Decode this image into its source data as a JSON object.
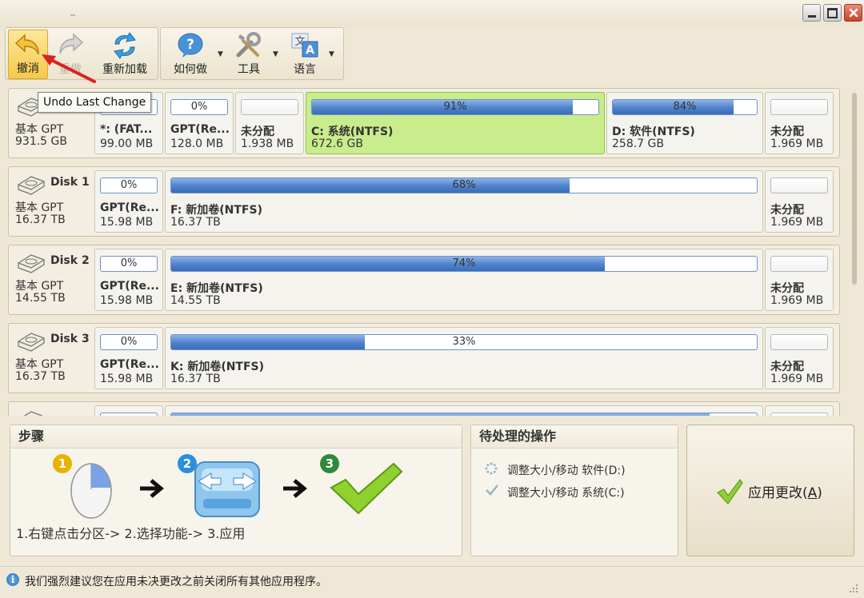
{
  "toolbar": {
    "undo": "撤消",
    "redo": "重做",
    "reload": "重新加载",
    "howto": "如何做",
    "tools": "工具",
    "language": "语言"
  },
  "tooltip": "Undo Last Change",
  "disks": [
    {
      "name": "",
      "type": "基本 GPT",
      "size": "931.5 GB",
      "partitions": [
        {
          "pct": "",
          "used": 0.0,
          "name": "*: (FAT...",
          "size": "99.00 MB",
          "empty": false
        },
        {
          "pct": "0%",
          "used": 0.0,
          "name": "GPT(Re...",
          "size": "128.0 MB",
          "empty": false
        },
        {
          "pct": "",
          "used": 0.0,
          "name": "未分配",
          "size": "1.938 MB",
          "empty": true
        },
        {
          "pct": "91%",
          "used": 0.91,
          "name": "C: 系统(NTFS)",
          "size": "672.6 GB",
          "empty": false,
          "selected": true
        },
        {
          "pct": "84%",
          "used": 0.84,
          "name": "D: 软件(NTFS)",
          "size": "258.7 GB",
          "empty": false
        },
        {
          "pct": "",
          "used": 0.0,
          "name": "未分配",
          "size": "1.969 MB",
          "empty": true
        }
      ]
    },
    {
      "name": "Disk 1",
      "type": "基本 GPT",
      "size": "16.37 TB",
      "partitions": [
        {
          "pct": "0%",
          "used": 0.0,
          "name": "GPT(Re...",
          "size": "15.98 MB",
          "empty": false
        },
        {
          "pct": "68%",
          "used": 0.68,
          "name": "F: 新加卷(NTFS)",
          "size": "16.37 TB",
          "empty": false
        },
        {
          "pct": "",
          "used": 0.0,
          "name": "未分配",
          "size": "1.969 MB",
          "empty": true
        }
      ]
    },
    {
      "name": "Disk 2",
      "type": "基本 GPT",
      "size": "14.55 TB",
      "partitions": [
        {
          "pct": "0%",
          "used": 0.0,
          "name": "GPT(Re...",
          "size": "15.98 MB",
          "empty": false
        },
        {
          "pct": "74%",
          "used": 0.74,
          "name": "E: 新加卷(NTFS)",
          "size": "14.55 TB",
          "empty": false
        },
        {
          "pct": "",
          "used": 0.0,
          "name": "未分配",
          "size": "1.969 MB",
          "empty": true
        }
      ]
    },
    {
      "name": "Disk 3",
      "type": "基本 GPT",
      "size": "16.37 TB",
      "partitions": [
        {
          "pct": "0%",
          "used": 0.0,
          "name": "GPT(Re...",
          "size": "15.98 MB",
          "empty": false
        },
        {
          "pct": "33%",
          "used": 0.33,
          "name": "K: 新加卷(NTFS)",
          "size": "16.37 TB",
          "empty": false
        },
        {
          "pct": "",
          "used": 0.0,
          "name": "未分配",
          "size": "1.969 MB",
          "empty": true
        }
      ]
    }
  ],
  "steps": {
    "title": "步骤",
    "caption": "1.右键点击分区-> 2.选择功能-> 3.应用",
    "n1": "1",
    "n2": "2",
    "n3": "3"
  },
  "pending": {
    "title": "待处理的操作",
    "op1": "调整大小/移动 软件(D:)",
    "op2": "调整大小/移动 系统(C:)"
  },
  "apply": {
    "label": "应用更改(",
    "key": "A",
    "end": ")"
  },
  "status": "我们强烈建议您在应用未决更改之前关闭所有其他应用程序。",
  "colors": {
    "accent": "#4f82cb",
    "selected": "#c9ec8c",
    "highlight": "#f6c94a"
  }
}
